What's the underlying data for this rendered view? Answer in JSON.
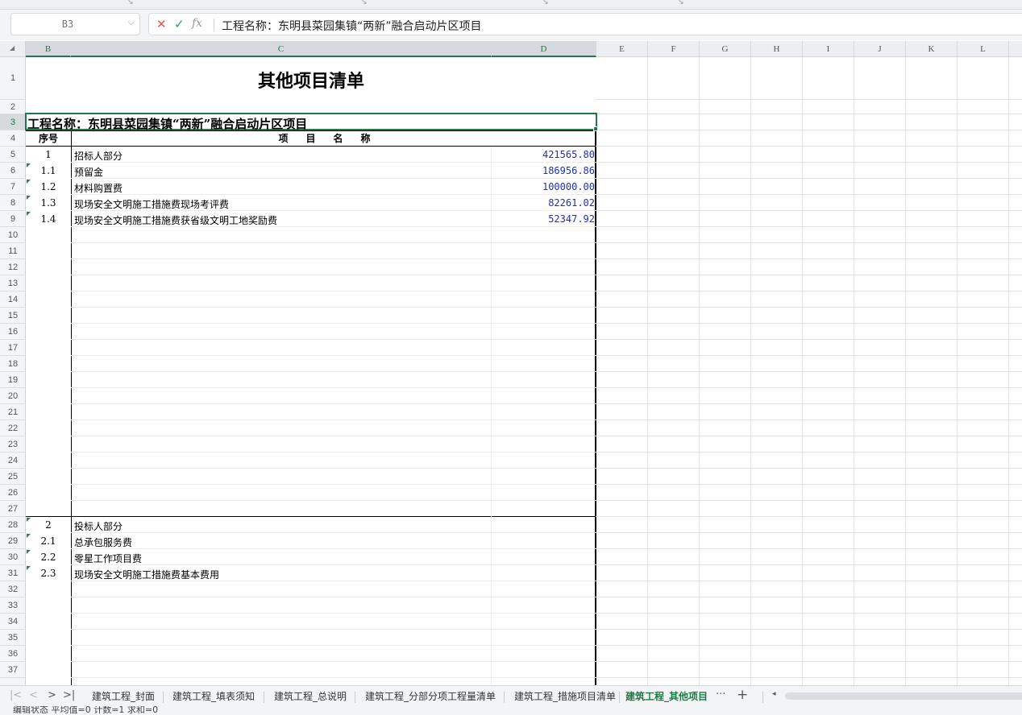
{
  "formula_bar": {
    "name_box": "B3",
    "cancel_icon": "✕",
    "enter_icon": "✓",
    "fx_label": "fx",
    "content": "工程名称：东明县菜园集镇“两新”融合启动片区项目"
  },
  "columns": [
    "B",
    "C",
    "D",
    "E",
    "F",
    "G",
    "H",
    "I",
    "J",
    "K",
    "L"
  ],
  "selected_columns": [
    "B",
    "C",
    "D"
  ],
  "selected_row": 3,
  "rows": [
    1,
    2,
    3,
    4,
    5,
    6,
    7,
    8,
    9,
    10,
    11,
    12,
    13,
    14,
    15,
    16,
    17,
    18,
    19,
    20,
    21,
    22,
    23,
    24,
    25,
    26,
    27,
    28,
    29,
    30,
    31,
    32,
    33,
    34,
    35,
    36,
    37
  ],
  "sheet": {
    "title": "其他项目清单",
    "project_name": "工程名称：东明县菜园集镇“两新”融合启动片区项目",
    "header_seq": "序号",
    "header_name": "项目名称",
    "items": [
      {
        "row": 5,
        "seq": "1",
        "name": "招标人部分",
        "amount": "421565.80",
        "marker": false
      },
      {
        "row": 6,
        "seq": "1.1",
        "name": "预留金",
        "amount": "186956.86",
        "marker": true
      },
      {
        "row": 7,
        "seq": "1.2",
        "name": "材料购置费",
        "amount": "100000.00",
        "marker": true
      },
      {
        "row": 8,
        "seq": "1.3",
        "name": "现场安全文明施工措施费现场考评费",
        "amount": "82261.02",
        "marker": true
      },
      {
        "row": 9,
        "seq": "1.4",
        "name": "现场安全文明施工措施费获省级文明工地奖励费",
        "amount": "52347.92",
        "marker": true
      },
      {
        "row": 28,
        "seq": "2",
        "name": "投标人部分",
        "amount": "",
        "marker": true
      },
      {
        "row": 29,
        "seq": "2.1",
        "name": "总承包服务费",
        "amount": "",
        "marker": true
      },
      {
        "row": 30,
        "seq": "2.2",
        "name": "零星工作项目费",
        "amount": "",
        "marker": true
      },
      {
        "row": 31,
        "seq": "2.3",
        "name": "现场安全文明施工措施费基本费用",
        "amount": "",
        "marker": true
      }
    ]
  },
  "tabs": {
    "nav": [
      "|<",
      "<",
      ">",
      ">|"
    ],
    "items": [
      {
        "label": "建筑工程_封面",
        "active": false
      },
      {
        "label": "建筑工程_填表须知",
        "active": false
      },
      {
        "label": "建筑工程_总说明",
        "active": false
      },
      {
        "label": "建筑工程_分部分项工程量清单",
        "active": false
      },
      {
        "label": "建筑工程_措施项目清单",
        "active": false
      },
      {
        "label": "建筑工程_其他项目",
        "active": true
      }
    ],
    "more_label": "···",
    "add_label": "+"
  },
  "status_bar": {
    "text": "编辑状态  平均值=0  计数=1  求和=0"
  },
  "colors": {
    "accent": "#1d7a45",
    "amount_text": "#1b2fb8"
  }
}
